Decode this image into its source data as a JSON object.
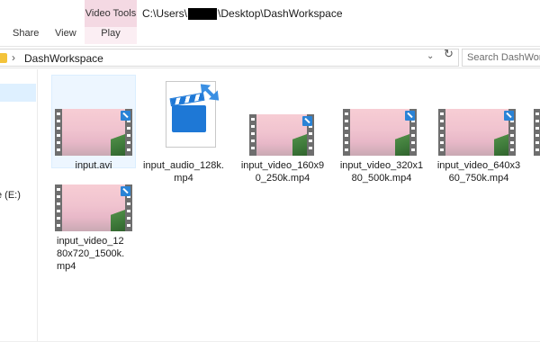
{
  "titlebar": {
    "context_tab": "Video Tools",
    "path_prefix": "C:\\Users\\",
    "path_suffix": "\\Desktop\\DashWorkspace"
  },
  "ribbon": {
    "tabs": [
      {
        "label": "Share"
      },
      {
        "label": "View"
      },
      {
        "label": "Play"
      }
    ]
  },
  "address": {
    "current_folder": "DashWorkspace"
  },
  "search": {
    "placeholder": "Search DashWorkspace"
  },
  "navpane": {
    "drive_label": "e (E:)"
  },
  "files": [
    {
      "name": "input.avi",
      "type": "video",
      "icon": "video-thumbnail"
    },
    {
      "name": "input_audio_128k.mp4",
      "type": "audio",
      "icon": "media-file-icon"
    },
    {
      "name": "input_video_160x90_250k.mp4",
      "type": "video",
      "icon": "video-thumbnail"
    },
    {
      "name": "input_video_320x180_500k.mp4",
      "type": "video",
      "icon": "video-thumbnail"
    },
    {
      "name": "input_video_640x360_750k.mp4",
      "type": "video",
      "icon": "video-thumbnail"
    },
    {
      "name": "input_video_1280x720_1500k.mp4",
      "type": "video",
      "icon": "video-thumbnail"
    }
  ],
  "colors": {
    "context_tab_bg": "#f4d9e3",
    "selection": "#cce8ff",
    "accent_blue": "#1e78d6"
  }
}
